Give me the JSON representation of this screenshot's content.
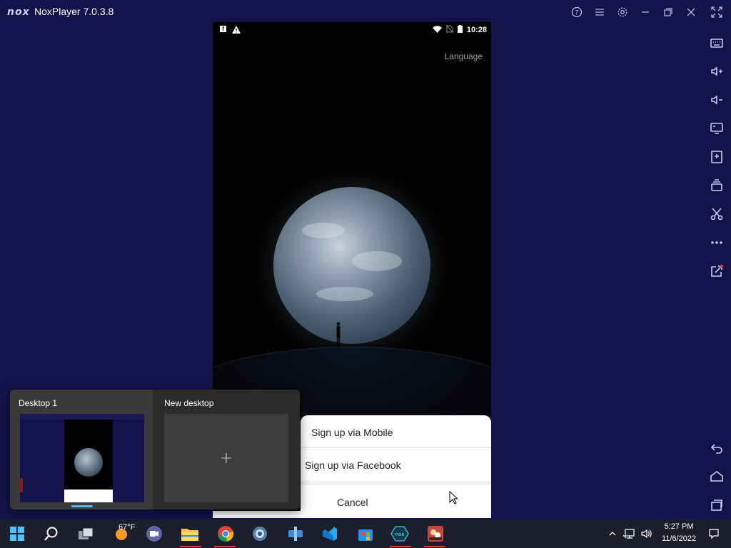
{
  "window": {
    "logo": "nox",
    "title": "NoxPlayer 7.0.3.8",
    "controls": [
      "help-icon",
      "menu-icon",
      "settings-icon",
      "minimize-icon",
      "restore-icon",
      "close-icon",
      "fullscreen-icon"
    ]
  },
  "sidebar": {
    "items": [
      "keyboard-icon",
      "volume-up-icon",
      "volume-down-icon",
      "screen-icon",
      "add-apk-icon",
      "multi-instance-icon",
      "scissors-icon",
      "more-icon",
      "share-icon",
      "back-icon",
      "home-icon",
      "recents-icon"
    ]
  },
  "android": {
    "status": {
      "time": "10:28"
    },
    "language_label": "Language",
    "sheet": {
      "option_mobile": "Sign up via Mobile",
      "option_facebook": "Sign up via Facebook",
      "cancel": "Cancel"
    }
  },
  "taskview": {
    "desktop1_label": "Desktop 1",
    "new_desktop_label": "New desktop",
    "new_desktop_plus": "+"
  },
  "taskbar": {
    "weather_temp": "67°F",
    "clock_time": "5:27 PM",
    "clock_date": "11/6/2022",
    "accent": "#e03b3b"
  }
}
